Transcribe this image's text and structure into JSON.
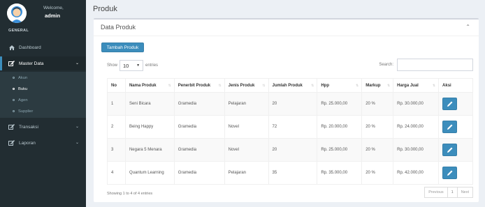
{
  "sidebar": {
    "welcome": "Welcome,",
    "username": "admin",
    "section_header": "GENERAL",
    "items": [
      {
        "label": "Dashboard",
        "icon": "home-icon"
      },
      {
        "label": "Master Data",
        "icon": "edit-icon"
      },
      {
        "label": "Transaksi",
        "icon": "edit-icon"
      },
      {
        "label": "Laporan",
        "icon": "edit-icon"
      }
    ],
    "submenu": [
      {
        "label": "Akun"
      },
      {
        "label": "Buku"
      },
      {
        "label": "Agen"
      },
      {
        "label": "Supplier"
      }
    ],
    "colors": {
      "background": "#222d32",
      "active": "#1e282c",
      "accent": "#3c8dbc"
    }
  },
  "page": {
    "title": "Produk",
    "box_title": "Data Produk",
    "add_button": "Tambah Produk",
    "show_label": "Show",
    "entries_value": "10",
    "entries_label": "entries",
    "search_label": "Search:",
    "search_value": ""
  },
  "table": {
    "headers": [
      "No",
      "Nama Produk",
      "Penerbit Produk",
      "Jenis Produk",
      "Jumlah Produk",
      "Hpp",
      "Markup",
      "Harga Jual",
      "Aksi"
    ],
    "rows": [
      [
        "1",
        "Seni Bicara",
        "Gramedia",
        "Pelajaran",
        "20",
        "Rp. 25.000,00",
        "20 %",
        "Rp. 30.000,00"
      ],
      [
        "2",
        "Being Happy",
        "Gramedia",
        "Novel",
        "72",
        "Rp. 20.000,00",
        "20 %",
        "Rp. 24.000,00"
      ],
      [
        "3",
        "Negara 5 Menara",
        "Gramedia",
        "Novel",
        "20",
        "Rp. 25.000,00",
        "20 %",
        "Rp. 30.000,00"
      ],
      [
        "4",
        "Quantum Learning",
        "Gramedia",
        "Pelajaran",
        "35",
        "Rp. 35.000,00",
        "20 %",
        "Rp. 42.000,00"
      ]
    ]
  },
  "footer": {
    "info": "Showing 1 to 4 of 4 entries",
    "previous": "Previous",
    "current_page": "1",
    "next": "Next"
  }
}
